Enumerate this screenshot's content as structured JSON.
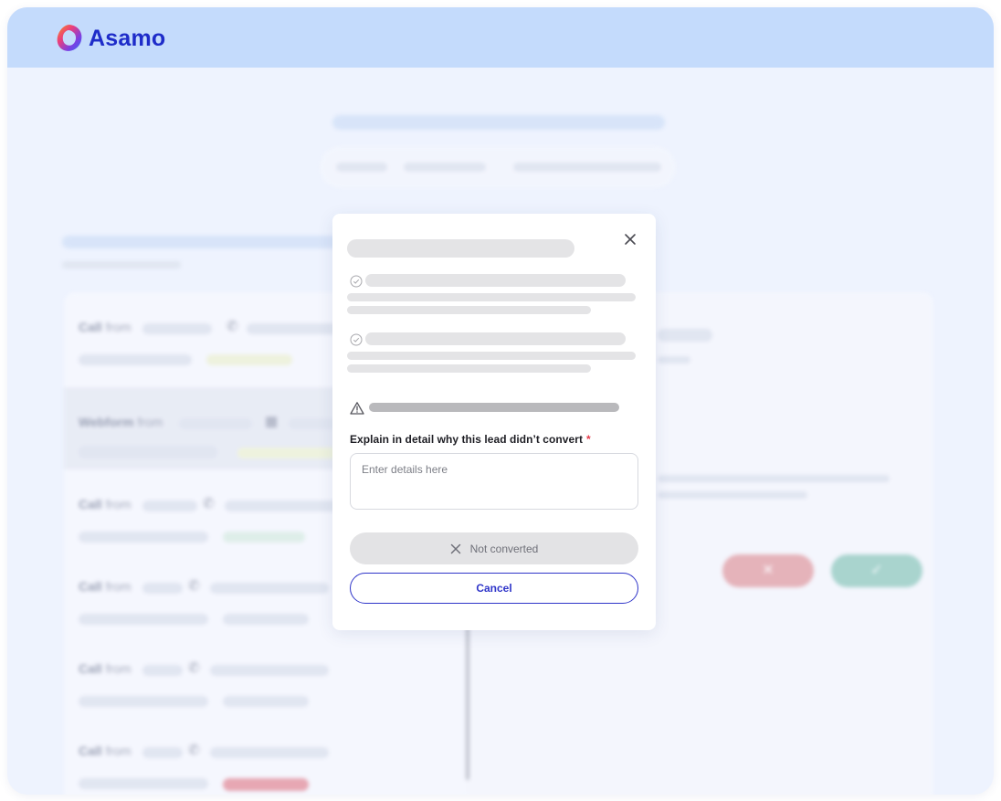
{
  "app": {
    "logo_text": "Asamo",
    "brand_color": "#1e2cc9"
  },
  "background_list": {
    "rows": [
      {
        "source": "Call",
        "from": "from",
        "icon": "phone-icon"
      },
      {
        "source": "Webform",
        "from": "from",
        "icon": "calendar-icon"
      },
      {
        "source": "Call",
        "from": "from",
        "icon": "phone-icon"
      },
      {
        "source": "Call",
        "from": "from",
        "icon": "phone-icon"
      },
      {
        "source": "Call",
        "from": "from",
        "icon": "phone-icon"
      },
      {
        "source": "Call",
        "from": "from",
        "icon": "phone-icon"
      }
    ],
    "reject_icon": "✕",
    "accept_icon": "✓"
  },
  "modal": {
    "close_icon": "close-icon",
    "reason_label": "Explain in detail why this lead didn’t convert",
    "required_mark": "*",
    "details_placeholder": "Enter details here",
    "not_converted_label": "Not converted",
    "cancel_label": "Cancel",
    "accent_color": "#2f35c9",
    "required_color": "#e53b4a"
  }
}
